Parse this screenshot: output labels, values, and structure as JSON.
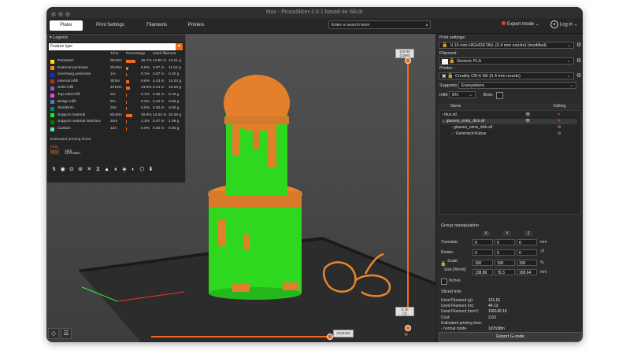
{
  "window": {
    "title": "titus - PrusaSlicer-2.8.1 based on Slic3r"
  },
  "tabs": [
    {
      "label": "Plater",
      "active": true
    },
    {
      "label": "Print Settings",
      "active": false
    },
    {
      "label": "Filaments",
      "active": false
    },
    {
      "label": "Printers",
      "active": false
    }
  ],
  "search": {
    "placeholder": "Enter a search term"
  },
  "mode": {
    "label": "Expert mode",
    "color": "#e8402a"
  },
  "login": {
    "label": "Log in"
  },
  "legend": {
    "title": "Legend",
    "view_type": "Feature type",
    "columns": {
      "time": "Time",
      "percentage": "Percentage",
      "filament": "Used filament"
    },
    "rows": [
      {
        "name": "Perimeter",
        "color": "#ffe600",
        "time": "9h43m",
        "pct": "30.7%",
        "fil_m": "14.82 m",
        "fil_g": "44.21 g",
        "fraction": 0.307
      },
      {
        "name": "External perimeter",
        "color": "#ff7d38",
        "time": "2h43m",
        "pct": "8.6%",
        "fil_m": "3.87 m",
        "fil_g": "11.54 g",
        "fraction": 0.086
      },
      {
        "name": "Overhang perimeter",
        "color": "#1f1fff",
        "time": "1m",
        "pct": "0.1%",
        "fil_m": "0.07 m",
        "fil_g": "0.20 g",
        "fraction": 0.001
      },
      {
        "name": "Internal infill",
        "color": "#b03029",
        "time": "3h3m",
        "pct": "9.6%",
        "fil_m": "4.43 m",
        "fil_g": "13.20 g",
        "fraction": 0.096
      },
      {
        "name": "Solid infill",
        "color": "#9654cc",
        "time": "4h19m",
        "pct": "13.5%",
        "fil_m": "6.44 m",
        "fil_g": "19.20 g",
        "fraction": 0.135
      },
      {
        "name": "Top solid infill",
        "color": "#f040f0",
        "time": "2m",
        "pct": "0.1%",
        "fil_m": "0.05 m",
        "fil_g": "0.15 g",
        "fraction": 0.001
      },
      {
        "name": "Bridge infill",
        "color": "#4d80ba",
        "time": "5m",
        "pct": "0.2%",
        "fil_m": "0.22 m",
        "fil_g": "0.65 g",
        "fraction": 0.002
      },
      {
        "name": "Skirt/Brim",
        "color": "#00876e",
        "time": "33s",
        "pct": "0.0%",
        "fil_m": "0.00 m",
        "fil_g": "0.00 g",
        "fraction": 0.0
      },
      {
        "name": "Support material",
        "color": "#00ff00",
        "time": "6h40m",
        "pct": "20.8%",
        "fil_m": "13.53 m",
        "fil_g": "40.36 g",
        "fraction": 0.208
      },
      {
        "name": "Support material interface",
        "color": "#008000",
        "time": "20m",
        "pct": "1.1%",
        "fil_m": "0.47 m",
        "fil_g": "1.39 g",
        "fraction": 0.011
      },
      {
        "name": "Custom",
        "color": "#5ee0b8",
        "time": "12s",
        "pct": "0.0%",
        "fil_m": "0.00 m",
        "fil_g": "0.00 g",
        "fraction": 0.0
      }
    ],
    "est_label": "Estimated printing times:",
    "first_layer_label": "First layer:",
    "first_layer": "10m",
    "total_label": "Total:",
    "total": "1d7h38m"
  },
  "slider": {
    "top_value": "149.90",
    "top_layer": "(2298)",
    "bottom_value": "0.20",
    "bottom_layer": "(1)",
    "h_value": "2332463"
  },
  "right": {
    "print_settings_label": "Print settings:",
    "print_profile": "0.10 mm HIGHDETAIL (0.4 mm nozzle) (modified)",
    "filament_label": "Filament:",
    "filament": "Generic PLA",
    "printer_label": "Printer:",
    "printer": "Creality CR-6 SE (0.4 mm nozzle)",
    "supports_label": "Supports:",
    "supports": "Everywhere",
    "infill_label": "Infill:",
    "infill": "5%",
    "brim_label": "Brim:",
    "col_name": "Name",
    "col_editing": "Editing",
    "objects": [
      {
        "name": "titus.stl",
        "level": 0
      },
      {
        "name": "glasses_extra_dick.stl",
        "level": 0
      },
      {
        "name": "glasses_extra_dick.stl",
        "level": 1
      },
      {
        "name": "Generisch-Kubus",
        "level": 1
      }
    ],
    "group_title": "Group manipulation",
    "axes": [
      "X",
      "Y",
      "Z"
    ],
    "translate_label": "Translate:",
    "translate": [
      "0",
      "0",
      "0"
    ],
    "translate_unit": "mm",
    "rotate_label": "Rotate:",
    "rotate": [
      "0",
      "0",
      "0"
    ],
    "scale_label": "Scale:",
    "scale": [
      "100",
      "100",
      "100"
    ],
    "scale_unit": "%",
    "size_label": "Size [World]:",
    "size": [
      "138.86",
      "76.3",
      "168.64"
    ],
    "size_unit": "mm",
    "inches_label": "Inches",
    "sliced_title": "Sliced Info",
    "sliced": [
      {
        "k": "Used Filament (g):",
        "v": "131.61"
      },
      {
        "k": "Used Filament (m):",
        "v": "44.13"
      },
      {
        "k": "Used Filament (mm³):",
        "v": "106140.16"
      },
      {
        "k": "Cost:",
        "v": "2.63"
      },
      {
        "k": "Estimated printing time:",
        "v": ""
      },
      {
        "k": " - normal mode",
        "v": "1d7h38m"
      }
    ],
    "export_label": "Export G-code"
  }
}
